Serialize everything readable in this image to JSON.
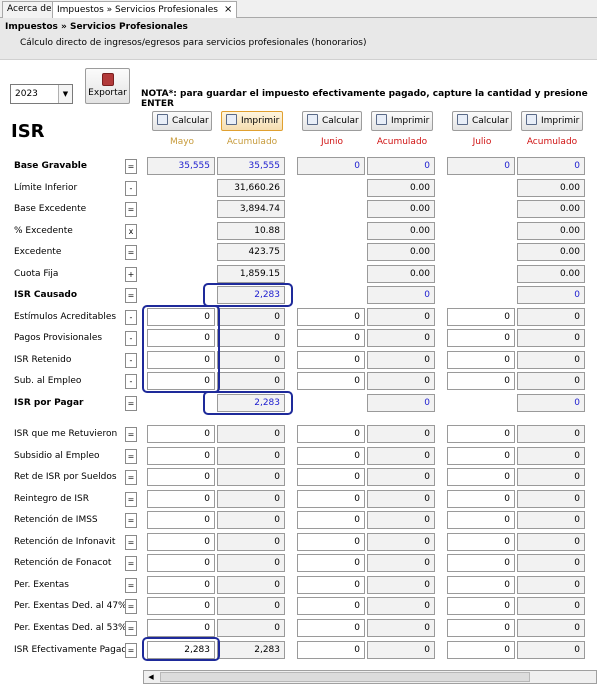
{
  "tabs": [
    {
      "label": "Acerca de"
    },
    {
      "label": "Impuestos » Servicios Profesionales",
      "close": "×"
    }
  ],
  "header": {
    "breadcrumb": "Impuestos » Servicios Profesionales",
    "subtitle": "Cálculo directo de ingresos/egresos para servicios profesionales (honorarios)"
  },
  "toolbar": {
    "year": "2023",
    "export_label": "Exportar",
    "note": "NOTA*: para guardar el impuesto efectivamente pagado, capture la cantidad y presione ENTER"
  },
  "section_title": "ISR",
  "buttons": {
    "calcular": "Calcular",
    "imprimir": "Imprimir"
  },
  "months": [
    {
      "name": "Mayo",
      "acc": "Acumulado"
    },
    {
      "name": "Junio",
      "acc": "Acumulado"
    },
    {
      "name": "Julio",
      "acc": "Acumulado"
    }
  ],
  "rows": [
    {
      "label": "Base Gravable",
      "op": "=",
      "v": [
        "35,555",
        "35,555",
        "0",
        "0",
        "0",
        "0"
      ]
    },
    {
      "label": "Límite Inferior",
      "op": "-",
      "v": [
        "",
        "31,660.26",
        "",
        "0.00",
        "",
        "0.00"
      ]
    },
    {
      "label": "Base Excedente",
      "op": "=",
      "v": [
        "",
        "3,894.74",
        "",
        "0.00",
        "",
        "0.00"
      ]
    },
    {
      "label": "% Excedente",
      "op": "x",
      "v": [
        "",
        "10.88",
        "",
        "0.00",
        "",
        "0.00"
      ]
    },
    {
      "label": "Excedente",
      "op": "=",
      "v": [
        "",
        "423.75",
        "",
        "0.00",
        "",
        "0.00"
      ]
    },
    {
      "label": "Cuota Fija",
      "op": "+",
      "v": [
        "",
        "1,859.15",
        "",
        "0.00",
        "",
        "0.00"
      ]
    },
    {
      "label": "ISR Causado",
      "op": "=",
      "v": [
        "",
        "2,283",
        "",
        "0",
        "",
        "0"
      ]
    },
    {
      "label": "Estímulos Acreditables",
      "op": "-",
      "v": [
        "0",
        "0",
        "0",
        "0",
        "0",
        "0"
      ]
    },
    {
      "label": "Pagos Provisionales",
      "op": "-",
      "v": [
        "0",
        "0",
        "0",
        "0",
        "0",
        "0"
      ]
    },
    {
      "label": "ISR Retenido",
      "op": "-",
      "v": [
        "0",
        "0",
        "0",
        "0",
        "0",
        "0"
      ]
    },
    {
      "label": "Sub. al Empleo",
      "op": "-",
      "v": [
        "0",
        "0",
        "0",
        "0",
        "0",
        "0"
      ]
    },
    {
      "label": "ISR por Pagar",
      "op": "=",
      "v": [
        "",
        "2,283",
        "",
        "0",
        "",
        "0"
      ]
    },
    {
      "label": "ISR que me Retuvieron",
      "op": "=",
      "v": [
        "0",
        "0",
        "0",
        "0",
        "0",
        "0"
      ]
    },
    {
      "label": "Subsidio al Empleo",
      "op": "=",
      "v": [
        "0",
        "0",
        "0",
        "0",
        "0",
        "0"
      ]
    },
    {
      "label": "Ret de ISR por Sueldos",
      "op": "=",
      "v": [
        "0",
        "0",
        "0",
        "0",
        "0",
        "0"
      ]
    },
    {
      "label": "Reintegro de ISR",
      "op": "=",
      "v": [
        "0",
        "0",
        "0",
        "0",
        "0",
        "0"
      ]
    },
    {
      "label": "Retención de IMSS",
      "op": "=",
      "v": [
        "0",
        "0",
        "0",
        "0",
        "0",
        "0"
      ]
    },
    {
      "label": "Retención de Infonavit",
      "op": "=",
      "v": [
        "0",
        "0",
        "0",
        "0",
        "0",
        "0"
      ]
    },
    {
      "label": "Retención de Fonacot",
      "op": "=",
      "v": [
        "0",
        "0",
        "0",
        "0",
        "0",
        "0"
      ]
    },
    {
      "label": "Per. Exentas",
      "op": "=",
      "v": [
        "0",
        "0",
        "0",
        "0",
        "0",
        "0"
      ]
    },
    {
      "label": "Per. Exentas Ded. al 47%",
      "op": "=",
      "v": [
        "0",
        "0",
        "0",
        "0",
        "0",
        "0"
      ]
    },
    {
      "label": "Per. Exentas Ded. al 53%",
      "op": "=",
      "v": [
        "0",
        "0",
        "0",
        "0",
        "0",
        "0"
      ]
    },
    {
      "label": "ISR Efectivamente Pagado",
      "op": "=",
      "v": [
        "2,283",
        "2,283",
        "0",
        "0",
        "0",
        "0"
      ]
    }
  ],
  "colors": {
    "highlight": "#1e2a9a",
    "blue_value": "#2020d0",
    "orange": "#c79b3b",
    "red": "#d01414"
  }
}
